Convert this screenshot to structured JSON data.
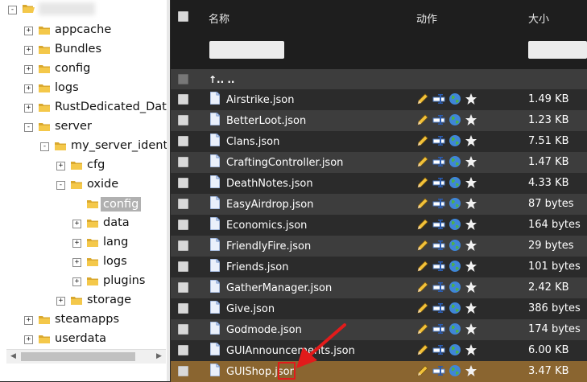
{
  "tree": {
    "root_label": "",
    "nodes": [
      {
        "label": "appcache",
        "level": 1,
        "toggle": "+"
      },
      {
        "label": "Bundles",
        "level": 1,
        "toggle": "+"
      },
      {
        "label": "config",
        "level": 1,
        "toggle": "+"
      },
      {
        "label": "logs",
        "level": 1,
        "toggle": "+"
      },
      {
        "label": "RustDedicated_Data",
        "level": 1,
        "toggle": "+"
      },
      {
        "label": "server",
        "level": 1,
        "toggle": "-"
      },
      {
        "label": "my_server_identity",
        "level": 2,
        "toggle": "-"
      },
      {
        "label": "cfg",
        "level": 3,
        "toggle": "+"
      },
      {
        "label": "oxide",
        "level": 3,
        "toggle": "-"
      },
      {
        "label": "config",
        "level": 4,
        "toggle": "",
        "selected": true
      },
      {
        "label": "data",
        "level": 4,
        "toggle": "+"
      },
      {
        "label": "lang",
        "level": 4,
        "toggle": "+"
      },
      {
        "label": "logs",
        "level": 4,
        "toggle": "+"
      },
      {
        "label": "plugins",
        "level": 4,
        "toggle": "+"
      },
      {
        "label": "storage",
        "level": 3,
        "toggle": "+"
      },
      {
        "label": "steamapps",
        "level": 1,
        "toggle": "+"
      },
      {
        "label": "userdata",
        "level": 1,
        "toggle": "+"
      }
    ]
  },
  "header": {
    "name_label": "名称",
    "action_label": "动作",
    "size_label": "大小"
  },
  "parent_row": {
    "label": "↑.. .."
  },
  "files": [
    {
      "name": "Airstrike.json",
      "size": "1.49 KB"
    },
    {
      "name": "BetterLoot.json",
      "size": "1.23 KB"
    },
    {
      "name": "Clans.json",
      "size": "7.51 KB"
    },
    {
      "name": "CraftingController.json",
      "size": "1.47 KB"
    },
    {
      "name": "DeathNotes.json",
      "size": "4.33 KB"
    },
    {
      "name": "EasyAirdrop.json",
      "size": "87 bytes"
    },
    {
      "name": "Economics.json",
      "size": "164 bytes"
    },
    {
      "name": "FriendlyFire.json",
      "size": "29 bytes"
    },
    {
      "name": "Friends.json",
      "size": "101 bytes"
    },
    {
      "name": "GatherManager.json",
      "size": "2.42 KB"
    },
    {
      "name": "Give.json",
      "size": "386 bytes"
    },
    {
      "name": "Godmode.json",
      "size": "174 bytes"
    },
    {
      "name": "GUIAnnouncements.json",
      "size": "6.00 KB"
    },
    {
      "name": "GUIShop.json",
      "size": "3.47 KB",
      "highlighted": true
    }
  ],
  "icons": {
    "actions": [
      "edit-pencil-icon",
      "rename-icon",
      "view-globe-icon",
      "favorite-star-icon"
    ]
  },
  "colors": {
    "row_even": "#2b2b2b",
    "row_odd": "#3d3d3d",
    "highlight_row": "#8a6530",
    "annotation_red": "#e21b1b"
  }
}
